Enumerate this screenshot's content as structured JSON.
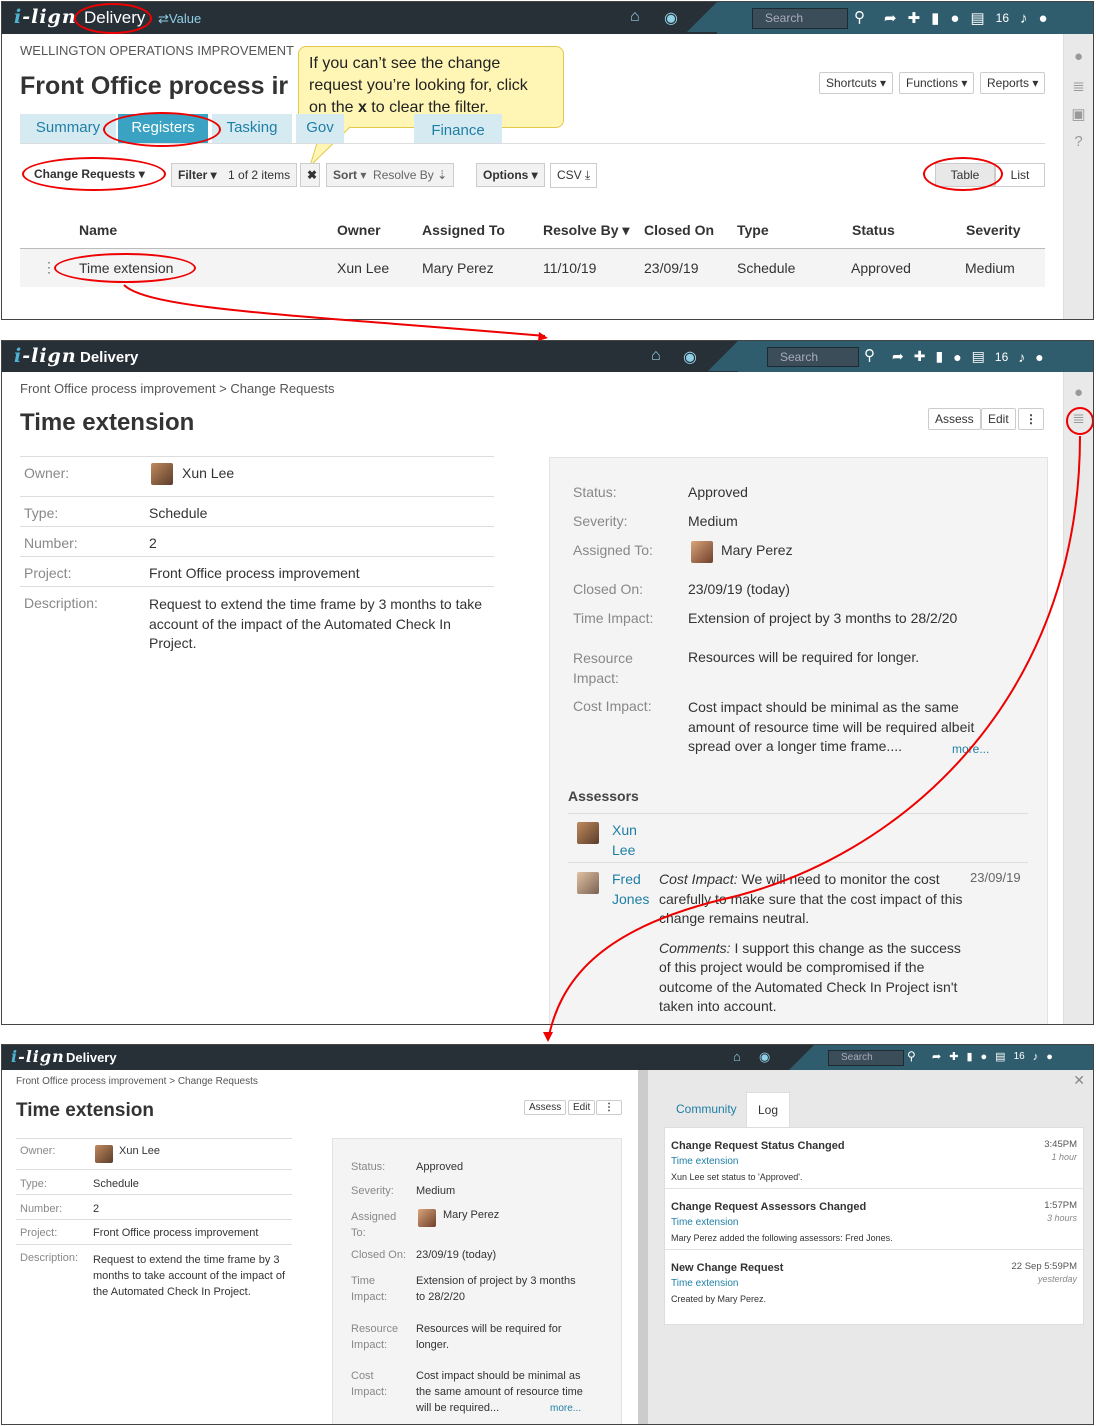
{
  "brand": {
    "logo": "i-lign",
    "app": "Delivery",
    "value_link": "Value"
  },
  "topbar": {
    "search_placeholder": "Search",
    "notif_count": "16"
  },
  "panel1": {
    "breadcrumb": "WELLINGTON OPERATIONS IMPROVEMENT",
    "title": "Front Office process ir",
    "tabs": [
      "Summary",
      "Registers",
      "Tasking",
      "Gov",
      "Finance"
    ],
    "buttons": {
      "shortcuts": "Shortcuts",
      "functions": "Functions",
      "reports": "Reports"
    },
    "toolbar": {
      "register": "Change Requests",
      "filter": "Filter",
      "count": "1 of 2 items",
      "sort": "Sort",
      "resolve": "Resolve By",
      "options": "Options",
      "csv": "CSV",
      "table": "Table",
      "list": "List"
    },
    "callout": {
      "line1": "If you can’t see the change",
      "line2": "request you’re looking for, click",
      "line3a": "on the",
      "line3x": "x",
      "line3b": "to clear the filter."
    },
    "columns": [
      "Name",
      "Owner",
      "Assigned To",
      "Resolve By",
      "Closed On",
      "Type",
      "Status",
      "Severity"
    ],
    "row": [
      "Time extension",
      "Xun Lee",
      "Mary Perez",
      "11/10/19",
      "23/09/19",
      "Schedule",
      "Approved",
      "Medium"
    ]
  },
  "detail": {
    "breadcrumb": "Front Office process improvement > Change Requests",
    "title": "Time extension",
    "buttons": {
      "assess": "Assess",
      "edit": "Edit"
    },
    "left": {
      "owner_label": "Owner:",
      "owner": "Xun Lee",
      "type_label": "Type:",
      "type": "Schedule",
      "number_label": "Number:",
      "number": "2",
      "project_label": "Project:",
      "project": "Front Office process improvement",
      "desc_label": "Description:",
      "desc_l1": "Request to extend the time frame by 3 months to take",
      "desc_l2": "account of the impact of the Automated Check In",
      "desc_l3": "Project."
    },
    "right": {
      "status_label": "Status:",
      "status": "Approved",
      "severity_label": "Severity:",
      "severity": "Medium",
      "assigned_label": "Assigned To:",
      "assigned": "Mary Perez",
      "closed_label": "Closed On:",
      "closed": "23/09/19 (today)",
      "time_label": "Time Impact:",
      "time": "Extension of project by 3 months to 28/2/20",
      "res_label1": "Resource",
      "res_label2": "Impact:",
      "res": "Resources will be required for longer.",
      "cost_label": "Cost Impact:",
      "cost_l1": "Cost impact should be minimal as the same",
      "cost_l2": "amount of resource time will be required albeit",
      "cost_l3": "spread over a longer time frame....",
      "more": "more..."
    },
    "assessors": {
      "heading": "Assessors",
      "a1_first": "Xun",
      "a1_last": "Lee",
      "a2_first": "Fred",
      "a2_last": "Jones",
      "a2_date": "23/09/19",
      "cost_title": "Cost Impact:",
      "cost_l1": "We will need to monitor the cost",
      "cost_l2": "carefully to make sure that the cost impact of this",
      "cost_l3": "change remains neutral.",
      "comments_title": "Comments:",
      "com_l1": "I support this change as the success",
      "com_l2": "of this project would be compromised if the",
      "com_l3": "outcome of the Automated Check In Project isn't",
      "com_l4": "taken into account."
    }
  },
  "panel3": {
    "left": {
      "res_label1": "Resource",
      "res_label2": "Impact:",
      "res_l1": "Resources will be required for",
      "res_l2": "longer.",
      "desc_l1": "Request to extend the time frame by 3",
      "desc_l2": "months to take account of the impact of",
      "desc_l3": "the Automated Check In Project.",
      "time_label1": "Time",
      "time_label2": "Impact:",
      "time_l1": "Extension of project by 3 months",
      "time_l2": "to 28/2/20",
      "assigned_label1": "Assigned",
      "assigned_label2": "To:",
      "cost_label1": "Cost",
      "cost_label2": "Impact:",
      "cost_l1": "Cost impact should be minimal as",
      "cost_l2": "the same amount of resource time",
      "cost_l3": "will be required..."
    },
    "tabs": [
      "Community",
      "Log"
    ],
    "log": [
      {
        "title": "Change Request Status Changed",
        "link": "Time extension",
        "text": "Xun Lee set status to 'Approved'.",
        "time": "3:45PM",
        "ago": "1 hour"
      },
      {
        "title": "Change Request Assessors Changed",
        "link": "Time extension",
        "text": "Mary Perez added the following assessors: Fred Jones.",
        "time": "1:57PM",
        "ago": "3 hours"
      },
      {
        "title": "New Change Request",
        "link": "Time extension",
        "text": "Created by Mary Perez.",
        "time": "22 Sep 5:59PM",
        "ago": "yesterday"
      }
    ]
  }
}
